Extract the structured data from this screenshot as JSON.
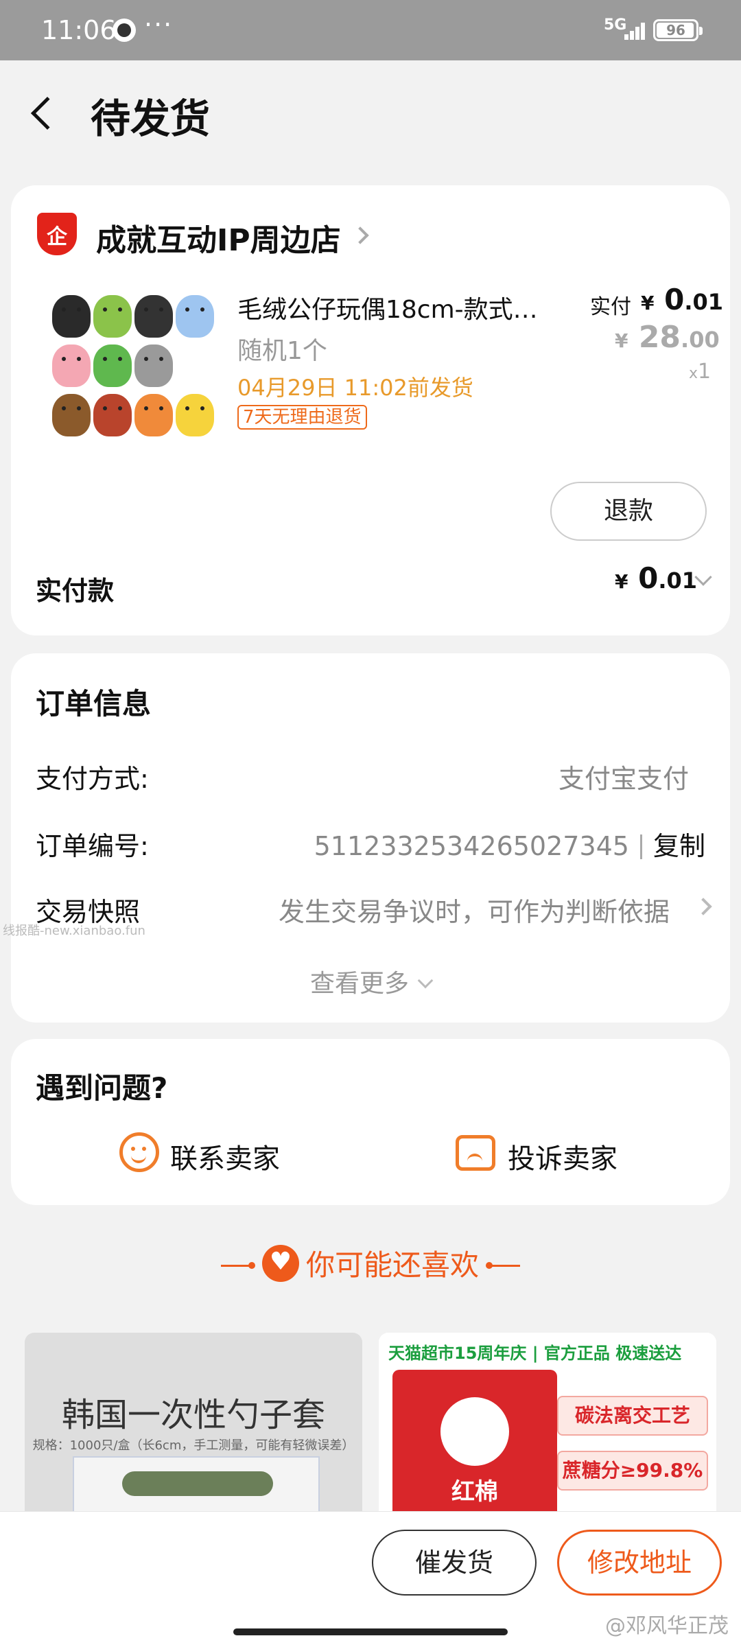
{
  "status_bar": {
    "time": "11:06",
    "dots": "···",
    "network": "5G",
    "battery": "96",
    "battery_level": 0.96
  },
  "header": {
    "title": "待发货"
  },
  "order": {
    "shop_icon_text": "企",
    "shop_name": "成就互动IP周边店",
    "product_name": "毛绒公仔玩偶18cm-款式…",
    "product_spec": "随机1个",
    "ship_deadline": "04月29日 11:02前发货",
    "tag": "7天无理由退货",
    "paid_label": "实付",
    "currency": "¥",
    "paid_int": "0",
    "paid_dec": ".01",
    "orig_int": "28",
    "orig_dec": ".00",
    "qty_x": "x",
    "qty": "1",
    "refund_label": "退款",
    "total_label": "实付款",
    "total_int": "0",
    "total_dec": ".01"
  },
  "order_info": {
    "title": "订单信息",
    "payment_label": "支付方式:",
    "payment_value": "支付宝支付",
    "order_no_label": "订单编号:",
    "order_no_value": "5112332534265027345",
    "copy_label": "复制",
    "snapshot_label": "交易快照",
    "snapshot_value": "发生交易争议时，可作为判断依据",
    "more_label": "查看更多"
  },
  "watermark": "线报酷-new.xianbao.fun",
  "problem": {
    "title": "遇到问题?",
    "contact_label": "联系卖家",
    "complain_label": "投诉卖家"
  },
  "recommend": {
    "title": "你可能还喜欢",
    "item1_title": "韩国一次性勺子套",
    "item1_spec": "规格：1000只/盒（长6cm，手工测量，可能有轻微误差）",
    "item2_banner": "天猫超市15周年庆 | 官方正品 极速送达",
    "item2_brand": "红棉",
    "item2_feature1": "碳法离交工艺",
    "item2_feature2": "蔗糖分≥99.8%"
  },
  "bottom_bar": {
    "urge_label": "催发货",
    "address_label": "修改地址"
  },
  "corner_watermark": "@邓风华正茂",
  "colors": {
    "accent": "#ee5a1b",
    "ship_text": "#e89a2b",
    "status_bar": "#9b9b9b",
    "page_bg": "#f2f2f2"
  },
  "icons": [
    "clock-icon",
    "signal-icon",
    "battery-icon",
    "back-icon",
    "shop-icon",
    "chevron-right-icon",
    "chevron-down-icon",
    "chat-icon",
    "complain-icon",
    "heart-icon"
  ]
}
